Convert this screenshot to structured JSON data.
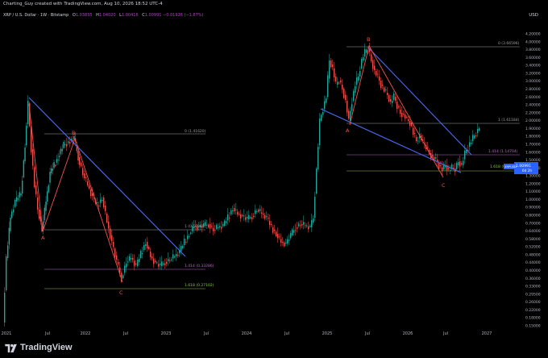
{
  "header": {
    "credit": "Charting_Guy created with TradingView.com, Aug 10, 2026 18:52 UTC-4",
    "currency": "USD"
  },
  "legend": {
    "symbol": "XRP / U.S. Dollar · 1W · Bitstamp",
    "open_label": "O",
    "open": "1.03835",
    "high_label": "H",
    "high": "1.04020",
    "low_label": "L",
    "low": "1.00416",
    "close_label": "C",
    "close": "1.00991",
    "change": "−0.01926 (−1.87%)"
  },
  "price_axis": {
    "labels": [
      "4.20000",
      "4.00000",
      "3.80000",
      "3.60000",
      "3.40000",
      "3.20000",
      "3.00000",
      "2.80000",
      "2.60000",
      "2.40000",
      "2.20000",
      "2.00000",
      "1.90000",
      "1.80000",
      "1.70000",
      "1.60000",
      "1.50000",
      "1.40000",
      "1.30000",
      "1.20000",
      "1.10000",
      "1.00000",
      "0.90000",
      "0.80000",
      "0.70000",
      "0.64000",
      "0.58000",
      "0.52000",
      "0.48000",
      "0.44000",
      "0.40000",
      "0.36000",
      "0.33000",
      "0.29500",
      "0.26000",
      "0.22000",
      "0.18000",
      "0.15000"
    ],
    "current_price": "1.00991",
    "current_symbol": "XRPUSD",
    "countdown": "6d 2h"
  },
  "time_axis": {
    "labels": [
      "2021",
      "Jul",
      "2022",
      "Jul",
      "2023",
      "Jul",
      "2024",
      "Jul",
      "2025",
      "Jul",
      "2026",
      "Jul",
      "2027"
    ]
  },
  "fib_levels": [
    {
      "id": "f1_0",
      "label": "0 (1.41620)",
      "color": "#9e9e9e"
    },
    {
      "id": "f1_1",
      "label": "1 (0.50969)",
      "color": "#9e9e9e"
    },
    {
      "id": "f1_1414",
      "label": "1.414 (0.33286)",
      "color": "#ba68c8"
    },
    {
      "id": "f1_1618",
      "label": "1.618 (0.27102)",
      "color": "#8bc34a"
    },
    {
      "id": "f2_0",
      "label": "0 (3.66596)",
      "color": "#9e9e9e"
    },
    {
      "id": "f2_1",
      "label": "1 (1.61184)",
      "color": "#9e9e9e"
    },
    {
      "id": "f2_1414",
      "label": "1.414 (1.14704)",
      "color": "#ba68c8"
    },
    {
      "id": "f2_1618",
      "label": "1.618 (0.99...)",
      "color": "#8bc34a"
    }
  ],
  "wave_labels": {
    "a1": "A",
    "b1": "B",
    "c1": "C",
    "a2": "A",
    "b2": "B",
    "c2": "C"
  },
  "colors": {
    "up": "#26a69a",
    "down": "#ef5350",
    "trend": "#4a6cf7",
    "wave": "#ef5350",
    "price_tag": "#2962ff"
  },
  "footer": {
    "brand": "TradingView"
  }
}
